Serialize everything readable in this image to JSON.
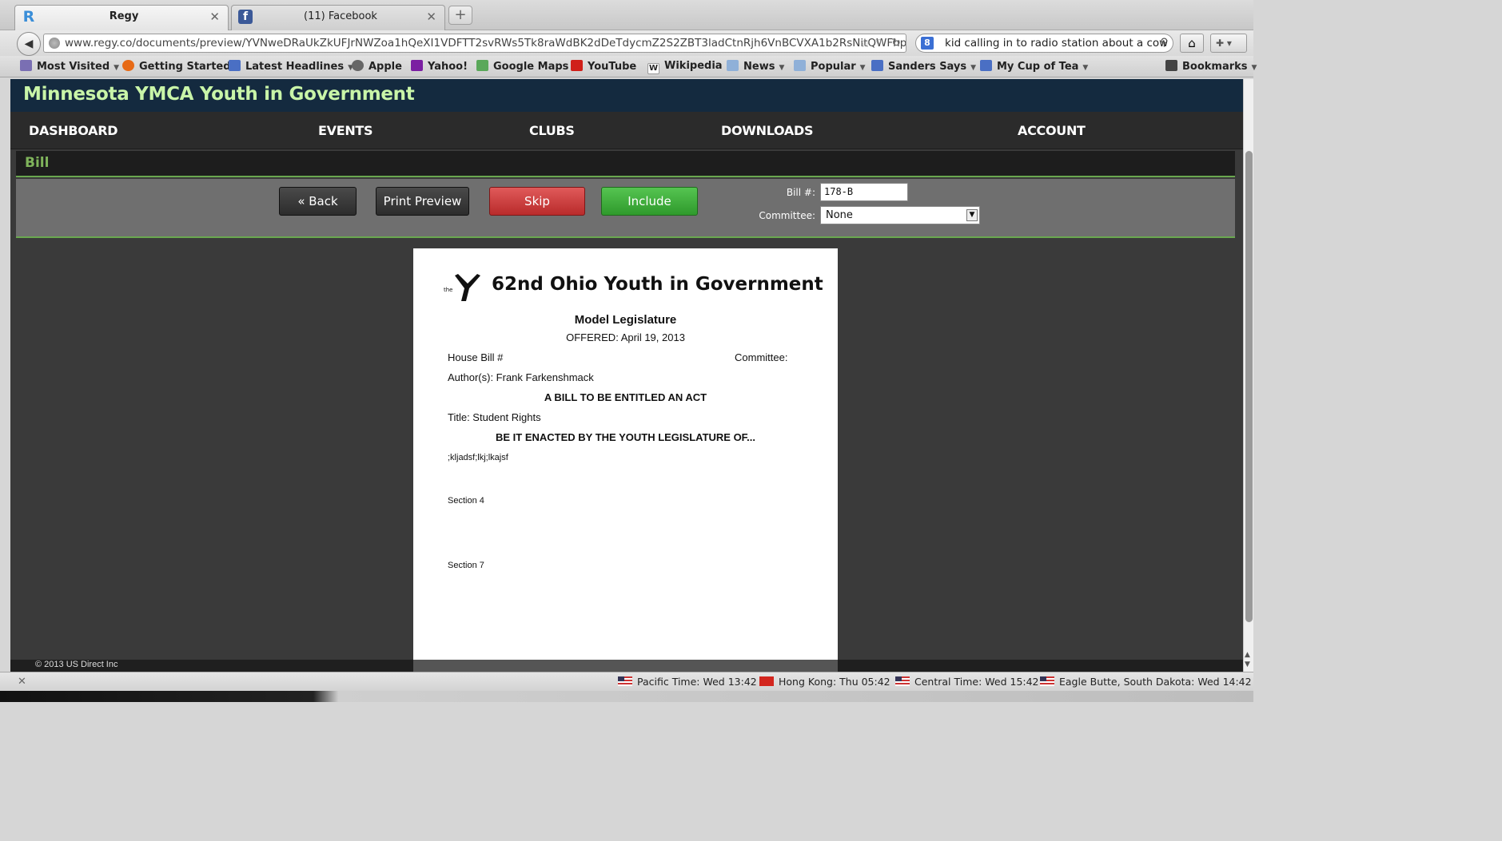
{
  "browser": {
    "tabs": [
      {
        "title": "Regy",
        "favicon": "R",
        "active": true
      },
      {
        "title": "(11) Facebook",
        "favicon": "f",
        "active": false
      }
    ],
    "url": "www.regy.co/documents/preview/YVNweDRaUkZkUFJrNWZoa1hQeXI1VDFTT2svRWs5Tk8raWdBK2dDeTdycmZ2S2ZBT3ladCtnRjh6VnBCVXA1b2RsNitQWFhp(",
    "search": "kid calling in to radio station about a cow",
    "bookmarks": [
      {
        "label": "Most Visited",
        "icon": "most-visited-icon",
        "dropdown": true
      },
      {
        "label": "Getting Started",
        "icon": "firefox-icon",
        "dropdown": false
      },
      {
        "label": "Latest Headlines",
        "icon": "rss-icon",
        "dropdown": true
      },
      {
        "label": "Apple",
        "icon": "apple-icon",
        "dropdown": false
      },
      {
        "label": "Yahoo!",
        "icon": "yahoo-icon",
        "dropdown": false
      },
      {
        "label": "Google Maps",
        "icon": "maps-icon",
        "dropdown": false
      },
      {
        "label": "YouTube",
        "icon": "youtube-icon",
        "dropdown": false
      },
      {
        "label": "Wikipedia",
        "icon": "wikipedia-icon",
        "dropdown": false
      },
      {
        "label": "News",
        "icon": "folder-icon",
        "dropdown": true
      },
      {
        "label": "Popular",
        "icon": "folder-icon",
        "dropdown": true
      },
      {
        "label": "Sanders  Says",
        "icon": "rss-icon",
        "dropdown": true
      },
      {
        "label": "My Cup of Tea",
        "icon": "rss-icon",
        "dropdown": true
      }
    ],
    "bookmarks_menu": "Bookmarks"
  },
  "site": {
    "title": "Minnesota YMCA Youth in Government",
    "nav": [
      "DASHBOARD",
      "EVENTS",
      "CLUBS",
      "DOWNLOADS",
      "ACCOUNT"
    ],
    "section_title": "Bill",
    "buttons": {
      "back": "« Back",
      "print_preview": "Print Preview",
      "skip": "Skip",
      "include": "Include"
    },
    "bill_number_label": "Bill #:",
    "bill_number_value": "178-B",
    "committee_label": "Committee:",
    "committee_value": "None",
    "footer": "© 2013 US Direct Inc"
  },
  "document": {
    "logo_text": "the",
    "title": "62nd Ohio Youth in Government",
    "subtitle": "Model Legislature",
    "offered": "OFFERED: April 19, 2013",
    "house_bill": "House Bill #",
    "committee": "Committee:",
    "authors": "Author(s): Frank Farkenshmack",
    "act_heading": "A BILL TO BE ENTITLED AN ACT",
    "title_line": "Title: Student Rights",
    "enacted": "BE IT ENACTED BY THE YOUTH LEGISLATURE OF...",
    "body": ";kljadsf;lkj;lkajsf",
    "section_a": "Section 4",
    "section_b": "Section 7"
  },
  "statusbar": {
    "clocks": [
      {
        "label": "Pacific Time: Wed 13:42",
        "flag": "us"
      },
      {
        "label": "Hong Kong: Thu 05:42",
        "flag": "hk"
      },
      {
        "label": "Central Time: Wed 15:42",
        "flag": "us"
      },
      {
        "label": "Eagle Butte, South Dakota: Wed 14:42",
        "flag": "us"
      }
    ]
  },
  "colors": {
    "header_bg": "#142a3f",
    "title_green": "#c9f5a8",
    "accent_green": "#6aa84f",
    "skip_red": "#c93a3a",
    "include_green": "#3fae3b"
  }
}
